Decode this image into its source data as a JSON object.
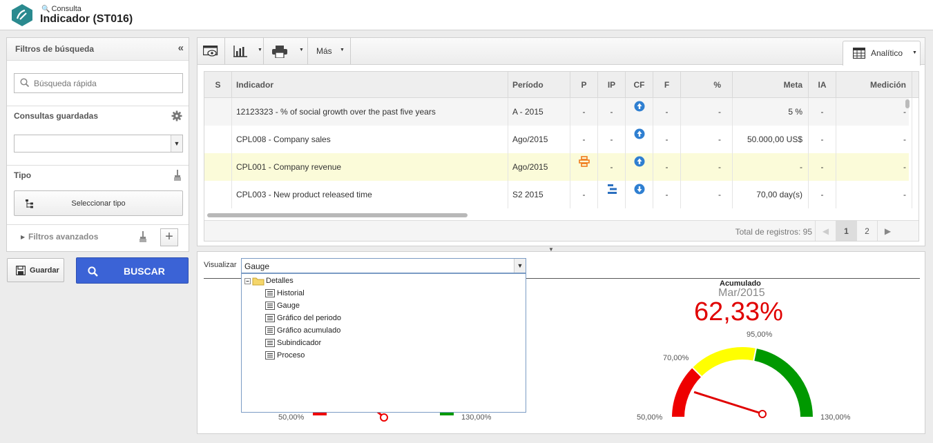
{
  "header": {
    "breadcrumb": "Consulta",
    "title": "Indicador (ST016)"
  },
  "filters": {
    "title": "Filtros de búsqueda",
    "search_placeholder": "Búsqueda rápida",
    "saved_queries_label": "Consultas guardadas",
    "type_label": "Tipo",
    "select_type_button": "Seleccionar tipo",
    "advanced_filters_label": "Filtros avanzados",
    "save_button": "Guardar",
    "search_button": "BUSCAR"
  },
  "toolbar": {
    "more_label": "Más",
    "view_tab_label": "Analítico"
  },
  "grid": {
    "columns": [
      "S",
      "Indicador",
      "Período",
      "P",
      "IP",
      "CF",
      "F",
      "%",
      "Meta",
      "IA",
      "Medición"
    ],
    "rows": [
      {
        "s": "",
        "indicador": "12123323 - % of social growth over the past five years",
        "periodo": "A - 2015",
        "p": "-",
        "ip": "-",
        "cf": "up",
        "f": "-",
        "pct": "-",
        "meta": "5 %",
        "ia": "-",
        "medicion": "-"
      },
      {
        "s": "",
        "indicador": "CPL008 - Company sales",
        "periodo": "Ago/2015",
        "p": "-",
        "ip": "-",
        "cf": "up",
        "f": "-",
        "pct": "-",
        "meta": "50.000,00 US$",
        "ia": "-",
        "medicion": "-"
      },
      {
        "s": "",
        "indicador": "CPL001 - Company revenue",
        "periodo": "Ago/2015",
        "p": "icon",
        "ip": "-",
        "cf": "up",
        "f": "-",
        "pct": "-",
        "meta": "-",
        "ia": "-",
        "medicion": "-"
      },
      {
        "s": "",
        "indicador": "CPL003 - New product released time",
        "periodo": "S2 2015",
        "p": "-",
        "ip": "icon",
        "cf": "down",
        "f": "-",
        "pct": "-",
        "meta": "70,00 day(s)",
        "ia": "-",
        "medicion": "-"
      }
    ],
    "total_label": "Total de registros: 95",
    "pages": [
      "1",
      "2"
    ],
    "current_page": "1"
  },
  "visualize": {
    "label": "Visualizar",
    "selected": "Gauge",
    "tree_root": "Detalles",
    "options": [
      "Historial",
      "Gauge",
      "Gráfico del periodo",
      "Gráfico acumulado",
      "Subindicador",
      "Proceso"
    ]
  },
  "gauge_left": {
    "min_label": "50,00%",
    "max_label": "130,00%"
  },
  "gauge_right": {
    "title": "Acumulado",
    "period": "Mar/2015",
    "value_label": "62,33%",
    "value": 62.33,
    "min": 50,
    "max": 130,
    "threshold_low_label": "70,00%",
    "threshold_high_label": "95,00%",
    "min_label": "50,00%",
    "max_label": "130,00%",
    "thresholds": [
      70,
      95
    ],
    "colors": {
      "low": "#ee0000",
      "mid": "#ffff00",
      "high": "#009900"
    }
  },
  "colors": {
    "accent_blue": "#3b63d6",
    "highlight_row": "#fbfbd9",
    "logo_teal": "#2a8a8f"
  }
}
